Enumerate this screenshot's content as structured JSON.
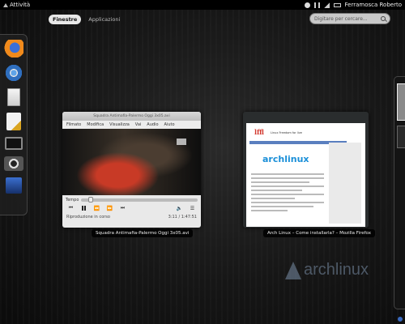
{
  "top_panel": {
    "activities_label": "Attività",
    "user_name": "Ferramosca Roberto"
  },
  "tabs": [
    {
      "label": "Finestre",
      "active": true
    },
    {
      "label": "Applicazioni",
      "active": false
    }
  ],
  "search": {
    "placeholder": "Digitare per cercare..."
  },
  "dash_icons": [
    "firefox-icon",
    "chromium-icon",
    "document-viewer-icon",
    "text-editor-icon",
    "terminal-icon",
    "camera-icon",
    "software-center-icon"
  ],
  "windows": [
    {
      "title_bar": "Squadra Antimafia-Palermo Oggi 3x05.avi",
      "caption": "Squadra Antimafia-Palermo Oggi 3x05.avi",
      "menu": [
        "Filmato",
        "Modifica",
        "Visualizza",
        "Vai",
        "Audio",
        "Aiuto"
      ],
      "tempo_label": "Tempo",
      "status_text": "Riproduzione in corso",
      "time_text": "3:11 / 1:47:51",
      "progress_fraction": 0.06
    },
    {
      "caption": "Arch Linux – Come installarla? – Mozilla Firefox",
      "page_logo": "lffl",
      "page_tagline": "Linux Freedom for live",
      "page_heading": "archlinux"
    }
  ],
  "desktop_logo": "archlinux"
}
